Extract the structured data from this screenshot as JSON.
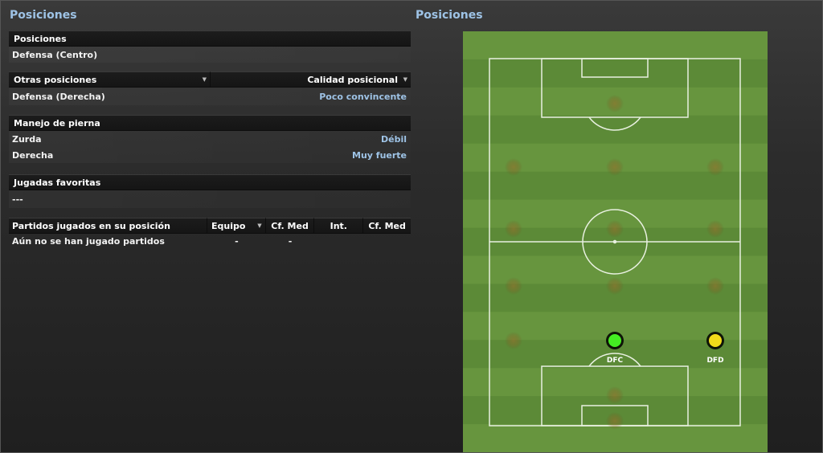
{
  "left_title": "Posiciones",
  "right_title": "Posiciones",
  "positions": {
    "header": "Posiciones",
    "value": "Defensa (Centro)"
  },
  "other_positions": {
    "header_left": "Otras posiciones",
    "header_right": "Calidad posicional",
    "rows": [
      {
        "position": "Defensa (Derecha)",
        "quality": "Poco convincente"
      }
    ]
  },
  "footedness": {
    "header": "Manejo de pierna",
    "rows": [
      {
        "label": "Zurda",
        "value": "Débil"
      },
      {
        "label": "Derecha",
        "value": "Muy fuerte"
      }
    ]
  },
  "favourite_moves": {
    "header": "Jugadas favoritas",
    "value": "---"
  },
  "matches": {
    "columns": [
      "Partidos jugados en su posición",
      "Equipo",
      "Cf. Med",
      "Int.",
      "Cf. Med"
    ],
    "row": [
      "Aún no se han jugado partidos",
      "-",
      "-",
      "",
      ""
    ]
  },
  "pitch": {
    "markers": [
      {
        "label": "DFC",
        "color": "#44ee22"
      },
      {
        "label": "DFD",
        "color": "#f2dc1a"
      }
    ]
  },
  "colors": {
    "accent": "#9ec3e6",
    "pitch_light": "#67953e",
    "pitch_dark": "#5c8a37"
  }
}
